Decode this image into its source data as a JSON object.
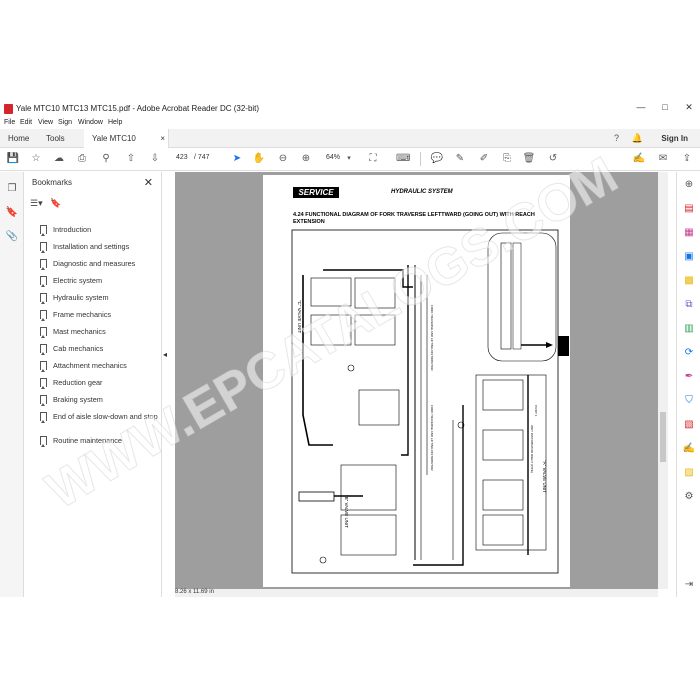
{
  "window": {
    "title": "Yale MTC10 MTC13 MTC15.pdf - Adobe Acrobat Reader DC (32-bit)",
    "minimize": "—",
    "maximize": "□",
    "close": "✕"
  },
  "menu": [
    "File",
    "Edit",
    "View",
    "Sign",
    "Window",
    "Help"
  ],
  "tabs": {
    "home": "Home",
    "tools": "Tools",
    "document": "Yale MTC10 MTC13...",
    "close": "×",
    "signin": "Sign In"
  },
  "toolbar": {
    "current_page": "423",
    "total_pages": "/ 747",
    "zoom": "64%"
  },
  "bookmarks": {
    "header": "Bookmarks",
    "close": "✕",
    "items": [
      "Introduction",
      "Installation and settings",
      "Diagnostic and measures",
      "Electric system",
      "Hydraulic system",
      "Frame mechanics",
      "Mast mechanics",
      "Cab mechanics",
      "Attachment mechanics",
      "Reduction gear",
      "Braking system",
      "End of aisle slow-down and stop",
      "Routine maintenance"
    ]
  },
  "page": {
    "badge": "SERVICE",
    "heading": "HYDRAULIC SYSTEM",
    "section": "4.24  FUNCTIONAL DIAGRAM OF FORK TRAVERSE LEFTTWARD (GOING OUT) WITH REACH EXTENSION",
    "labels": {
      "c_valve": "\"C\" VALVE UNIT",
      "b_valve": "\"B\" VALVE UNIT",
      "a_valve": "\"A\" VALVE UNIT",
      "fork_distributor": "FORK TRAVERSE AND LIFTING DISTRIBUTOR",
      "lift_distributor": "FORK TRAVERSE AND LIFTING DISTRIBUTOR",
      "unit_distributor": "UNIT DISTRIBUTOR RIGHT (PIPE)",
      "pivot_label": "PIVOT 1"
    }
  },
  "status": {
    "page_size": "8.26 x 11.69 in"
  },
  "watermark": "WWW.EPCATALOGS.COM",
  "colors": {
    "acrobat_red": "#d4252a",
    "accent_blue": "#1473e6",
    "doc_background": "#9e9e9e"
  }
}
